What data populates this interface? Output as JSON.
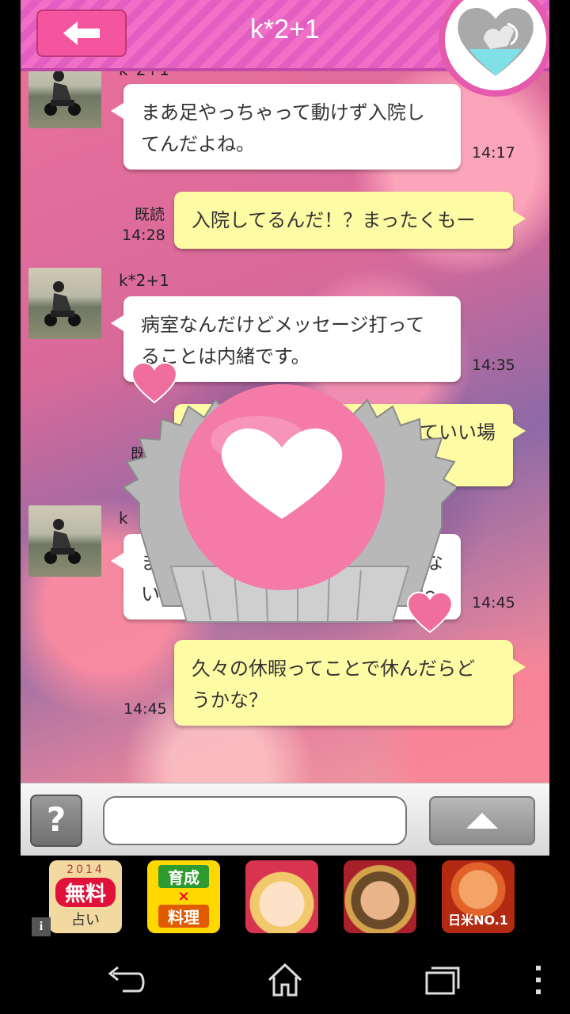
{
  "header": {
    "title": "k*2+1",
    "back_icon": "arrow-left-icon",
    "badge_icon": "cupid-heart-icon"
  },
  "messages": [
    {
      "side": "left",
      "sender": "k*2+1",
      "text_lines": [
        "まあ足やっちゃって動けず入院し",
        "てんだよね。"
      ],
      "time": "14:17"
    },
    {
      "side": "right",
      "read": "既読",
      "text_lines": [
        "入院してるんだ！？まったくもー"
      ],
      "time": "14:28"
    },
    {
      "side": "left",
      "sender": "k*2+1",
      "text_lines": [
        "病室なんだけどメッセージ打って",
        "ることは内緒です。"
      ],
      "time": "14:35"
    },
    {
      "side": "right",
      "read": "既",
      "text_lines": [
        "っていい場"
      ]
    },
    {
      "side": "left",
      "sender": "k",
      "text_lines": [
        "ま",
        "いっ"
      ],
      "text_lines_right": [
        "かな",
        "だな〜"
      ],
      "time": "14:45"
    },
    {
      "side": "right",
      "text_lines": [
        "久々の休暇ってことで休んだらど",
        "うかな？"
      ],
      "time": "14:45"
    }
  ],
  "overlay": {
    "icon": "heart-chocolate-icon"
  },
  "input_bar": {
    "help_label": "?",
    "input_value": "",
    "send_icon": "triangle-up-icon"
  },
  "ads": [
    {
      "name": "ad-fortune",
      "top_text": "2014",
      "main_text": "無料",
      "bottom_text": "占い",
      "color": "#f2d9a0"
    },
    {
      "name": "ad-cooking",
      "top_text": "育成",
      "mid_text": "×",
      "bottom_text": "料理",
      "color": "#ffd800"
    },
    {
      "name": "ad-anime-girl",
      "color": "#e84560"
    },
    {
      "name": "ad-warrior",
      "color": "#c88c3c"
    },
    {
      "name": "ad-clash",
      "bottom_text": "日米NO.1",
      "color": "#d23a20"
    }
  ],
  "nav": {
    "back_icon": "back-icon",
    "home_icon": "home-icon",
    "recents_icon": "recents-icon",
    "menu_icon": "menu-dots-icon"
  },
  "colors": {
    "header": "#e865c4",
    "yellow_bubble": "#fdfba4",
    "accent_pink": "#f5559e"
  }
}
